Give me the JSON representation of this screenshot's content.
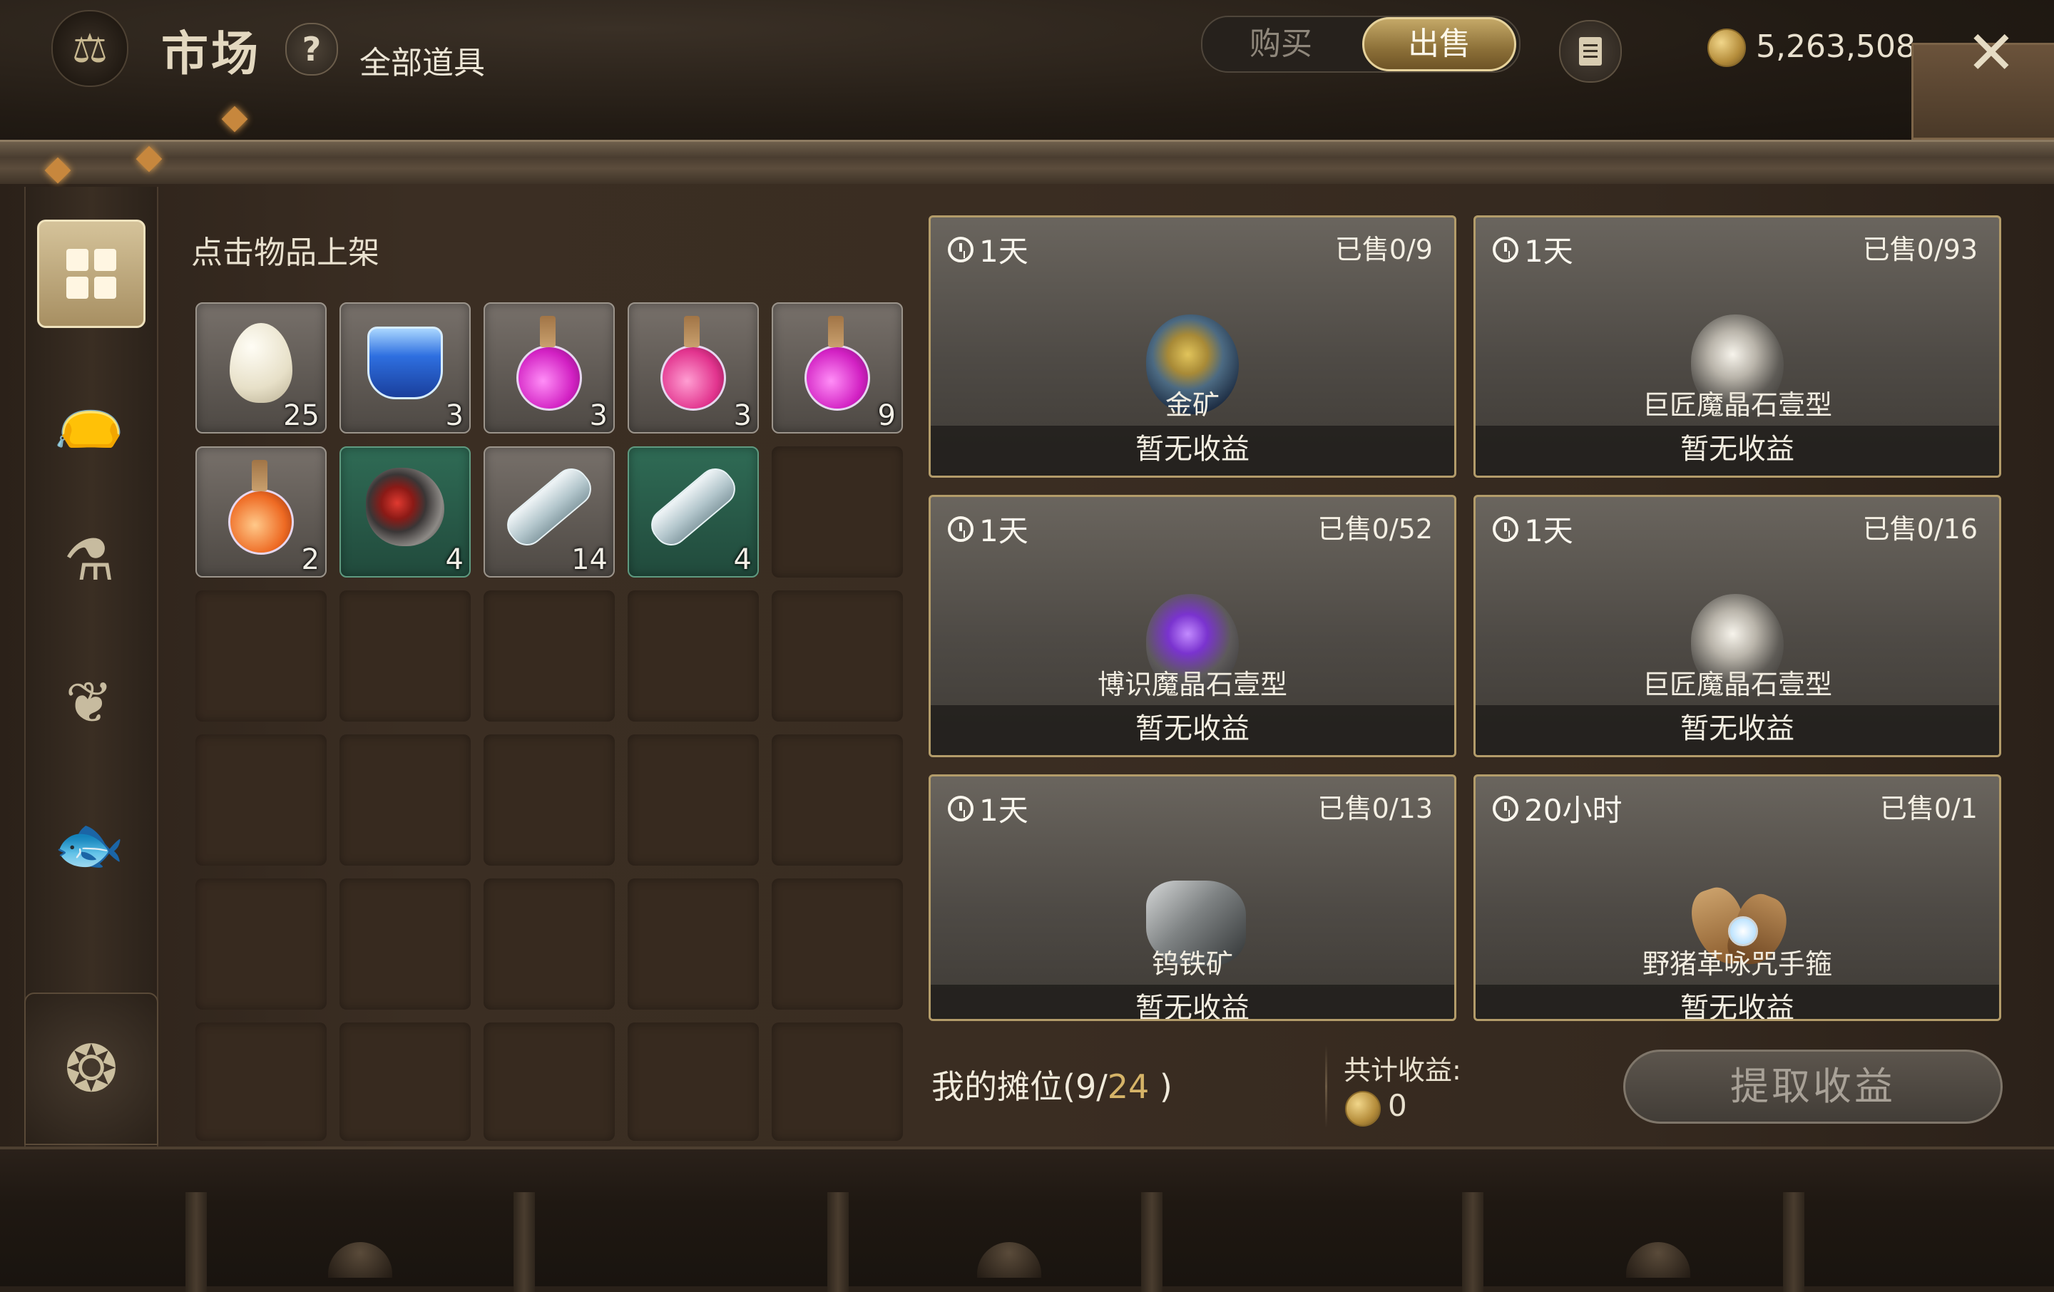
{
  "header": {
    "title": "市场",
    "help": "?",
    "category": "全部道具",
    "tabs": [
      {
        "label": "购买",
        "active": false
      },
      {
        "label": "出售",
        "active": true
      }
    ],
    "currency": "5,263,508"
  },
  "sidebar": {
    "items": [
      {
        "name": "all-items",
        "icon": "grid-icon",
        "active": true
      },
      {
        "name": "bag",
        "icon": "pouch-icon",
        "active": false
      },
      {
        "name": "potions",
        "icon": "flask-icon",
        "active": false
      },
      {
        "name": "plants",
        "icon": "leaf-icon",
        "active": false
      },
      {
        "name": "fish",
        "icon": "fish-icon",
        "active": false
      }
    ],
    "bottom_icon": "character-emblem-icon"
  },
  "inventory": {
    "title": "点击物品上架",
    "items": [
      {
        "icon": "egg-icon",
        "count": "25"
      },
      {
        "icon": "blue-glass-icon",
        "count": "3"
      },
      {
        "icon": "pink-potion-icon",
        "count": "3"
      },
      {
        "icon": "rose-potion-icon",
        "count": "3"
      },
      {
        "icon": "pink-potion-icon",
        "count": "9"
      },
      {
        "icon": "orange-potion-icon",
        "count": "2"
      },
      {
        "icon": "red-ore-icon",
        "count": "4"
      },
      {
        "icon": "message-bottle-icon",
        "count": "14"
      },
      {
        "icon": "message-bottle-icon",
        "count": "4"
      }
    ]
  },
  "listings": [
    {
      "time": "1天",
      "sold": "已售0/9",
      "name": "金矿",
      "income": "暂无收益",
      "icon": "gold-ore-icon"
    },
    {
      "time": "1天",
      "sold": "已售0/93",
      "name": "巨匠魔晶石壹型",
      "income": "暂无收益",
      "icon": "silver-crystal-icon"
    },
    {
      "time": "1天",
      "sold": "已售0/52",
      "name": "博识魔晶石壹型",
      "income": "暂无收益",
      "icon": "purple-crystal-icon"
    },
    {
      "time": "1天",
      "sold": "已售0/16",
      "name": "巨匠魔晶石壹型",
      "income": "暂无收益",
      "icon": "silver-crystal-icon"
    },
    {
      "time": "1天",
      "sold": "已售0/13",
      "name": "钨铁矿",
      "income": "暂无收益",
      "icon": "tungsten-ore-icon"
    },
    {
      "time": "20小时",
      "sold": "已售0/1",
      "name": "野猪革咏咒手箍",
      "income": "暂无收益",
      "icon": "gauntlet-icon"
    }
  ],
  "footer": {
    "stall_label": "我的摊位(",
    "stall_used": "9",
    "stall_sep": "/",
    "stall_max": "24",
    "stall_close": " )",
    "total_label": "共计收益:",
    "total_value": "0",
    "collect_button": "提取收益"
  },
  "colors": {
    "accent_gold": "#d6b468",
    "active_tab": "#c4a867",
    "listing_border": "#b39c6a"
  }
}
